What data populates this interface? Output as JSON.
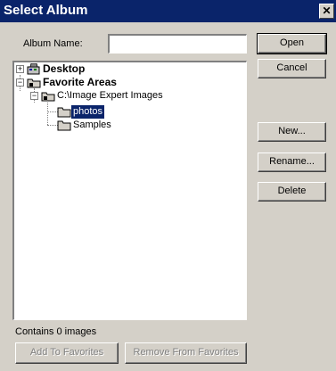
{
  "window": {
    "title": "Select Album",
    "close_glyph": "✕"
  },
  "album_name": {
    "label": "Album Name:",
    "value": ""
  },
  "buttons": {
    "open": "Open",
    "cancel": "Cancel",
    "new": "New...",
    "rename": "Rename...",
    "delete": "Delete",
    "add_to_favorites": "Add To Favorites",
    "remove_from_favorites": "Remove From Favorites"
  },
  "tree": {
    "items": [
      {
        "label": "Desktop",
        "expander": "+",
        "icon": "desktop-icon"
      },
      {
        "label": "Favorite Areas",
        "expander": "−",
        "icon": "favorites-folder-icon"
      },
      {
        "label": "C:\\Image Expert Images",
        "expander": "−",
        "icon": "favorites-folder-icon"
      },
      {
        "label": "photos",
        "icon": "folder-icon",
        "selected": true
      },
      {
        "label": "Samples",
        "icon": "folder-icon"
      }
    ]
  },
  "status": {
    "text": "Contains 0 images"
  },
  "colors": {
    "titlebar": "#0a246a",
    "face": "#d4d0c8",
    "selection": "#0a246a"
  }
}
